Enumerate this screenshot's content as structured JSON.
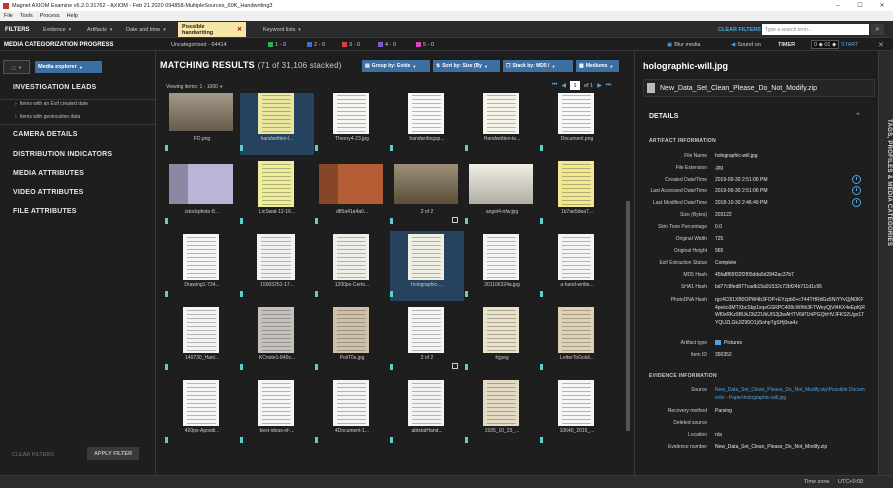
{
  "window": {
    "title": "Magnet AXIOM Examine v6.2.0.31762 - AXIOM - Feb 21 2020 094858-MultipleSources_60K_Handwriting3"
  },
  "menu": [
    "File",
    "Tools",
    "Process",
    "Help"
  ],
  "filter_bar": {
    "title": "FILTERS",
    "evidence": "Evidence",
    "artifacts": "Artifacts",
    "date_time": "Date and time",
    "active_filter": "Possible handwriting",
    "keyword": "Keyword lists",
    "clear": "CLEAR FILTERS",
    "search_placeholder": "Type a search term..."
  },
  "categorization": {
    "title": "MEDIA CATEGORIZATION PROGRESS",
    "uncategorized": "Uncategorized - 64414",
    "cats": [
      {
        "label": "1 - 0",
        "color": "#2eaf5a"
      },
      {
        "label": "2 - 0",
        "color": "#3b6fd4"
      },
      {
        "label": "3 - 0",
        "color": "#d44343"
      },
      {
        "label": "4 - 0",
        "color": "#7d5bc8"
      },
      {
        "label": "5 - 0",
        "color": "#d54ac2"
      }
    ],
    "blur": "Blur media",
    "sound": "Sound on",
    "timer": "TIMER",
    "timer_value": "0 ◆ 01 ◆",
    "start": "START"
  },
  "left_panel": {
    "explorer": "Media explorer",
    "investigation": "INVESTIGATION LEADS",
    "lead_items": [
      "Items with an Exif created date",
      "Items with geolocation data"
    ],
    "sections": [
      "CAMERA DETAILS",
      "DISTRIBUTION INDICATORS",
      "MEDIA ATTRIBUTES",
      "VIDEO ATTRIBUTES",
      "FILE ATTRIBUTES"
    ],
    "clear": "CLEAR FILTERS",
    "apply": "APPLY FILTER"
  },
  "results": {
    "title": "MATCHING RESULTS",
    "subtitle": "(71 of 31,106 stacked)",
    "group_by": "Group by: Evide",
    "sort_by": "Sort by: Size (By",
    "stack_by": "Stack by: MD5 /",
    "size": "Mediums",
    "viewing": "Viewing items: 1 - 1000",
    "page": "1",
    "page_of": "of 1",
    "items": [
      {
        "name": "FD.png",
        "tone": "#8a7a66",
        "kind": "photo",
        "tick": true,
        "stack": false
      },
      {
        "name": "handwritten-l...",
        "tone": "#ece7a0",
        "kind": "doc",
        "tick": true,
        "stack": false,
        "sel": true
      },
      {
        "name": "Theory4-23.jpg",
        "tone": "#f5f5f2",
        "kind": "doc",
        "tick": true,
        "stack": false
      },
      {
        "name": "handwritingsp...",
        "tone": "#f8f8f6",
        "kind": "doc",
        "tick": true,
        "stack": false
      },
      {
        "name": "Handwritten-le...",
        "tone": "#f5f3ea",
        "kind": "doc",
        "tick": true,
        "stack": false
      },
      {
        "name": "Document.png",
        "tone": "#f7f7f7",
        "kind": "doc",
        "tick": true,
        "stack": false
      },
      {
        "name": "istockphoto-8...",
        "tone": "#b9b5d8",
        "kind": "card",
        "tick": true,
        "stack": false
      },
      {
        "name": "LicSwat-12-16...",
        "tone": "#eeee99",
        "kind": "doc",
        "tick": true,
        "stack": false
      },
      {
        "name": "d85a41a4a0...",
        "tone": "#b55e36",
        "kind": "card",
        "tick": true,
        "stack": false
      },
      {
        "name": "2 of 2",
        "tone": "#7a6a4d",
        "kind": "photo",
        "tick": true,
        "stack": true
      },
      {
        "name": "angel4-nfw.jpg",
        "tone": "#ece8dc",
        "kind": "photo",
        "tick": true,
        "stack": false
      },
      {
        "name": "1b7ae5dea7...",
        "tone": "#f2e88e",
        "kind": "doc",
        "tick": true,
        "stack": false
      },
      {
        "name": "Drawing1-734...",
        "tone": "#f6f6f6",
        "kind": "doc",
        "tick": true,
        "stack": false
      },
      {
        "name": "15003251-17...",
        "tone": "#f1f1ef",
        "kind": "cert",
        "tick": true,
        "stack": false
      },
      {
        "name": "1200px-Certo...",
        "tone": "#efefe9",
        "kind": "doc",
        "tick": true,
        "stack": false
      },
      {
        "name": "holographic-...",
        "tone": "#efefe6",
        "kind": "doc",
        "tick": true,
        "stack": false,
        "sel": true
      },
      {
        "name": "201106324a.jpg",
        "tone": "#f4f4f4",
        "kind": "doc",
        "tick": true,
        "stack": false
      },
      {
        "name": "a-hand-writte...",
        "tone": "#f4f4f2",
        "kind": "doc",
        "tick": true,
        "stack": false
      },
      {
        "name": "140730_Hanl...",
        "tone": "#f3f3f3",
        "kind": "doc",
        "tick": true,
        "stack": false
      },
      {
        "name": "KCnote1-840x...",
        "tone": "#c6c2bb",
        "kind": "doc",
        "tick": true,
        "stack": false
      },
      {
        "name": "PoiiT0s.jpg",
        "tone": "#d0c0a8",
        "kind": "doc",
        "tick": true,
        "stack": false
      },
      {
        "name": "2 of 2",
        "tone": "#f4f4f4",
        "kind": "doc",
        "tick": true,
        "stack": true
      },
      {
        "name": "fcjpeg",
        "tone": "#e9e1c8",
        "kind": "doc",
        "tick": true,
        "stack": false
      },
      {
        "name": "LetterToGoldi...",
        "tone": "#dfd1b2",
        "kind": "doc",
        "tick": true,
        "stack": false
      },
      {
        "name": "420px-Apostil...",
        "tone": "#f6f6f6",
        "kind": "doc",
        "tick": true,
        "stack": false
      },
      {
        "name": "best-ideas-of-...",
        "tone": "#f5f5f5",
        "kind": "doc",
        "tick": true,
        "stack": false
      },
      {
        "name": "4Document-1...",
        "tone": "#f4f4f4",
        "kind": "doc",
        "tick": true,
        "stack": false
      },
      {
        "name": "abtstatHand...",
        "tone": "#f3f3f3",
        "kind": "doc",
        "tick": true,
        "stack": false
      },
      {
        "name": "1935_10_23_...",
        "tone": "#e5dac3",
        "kind": "doc",
        "tick": true,
        "stack": false
      },
      {
        "name": "10640_2015_...",
        "tone": "#f5f5f5",
        "kind": "doc",
        "tick": true,
        "stack": false
      }
    ]
  },
  "details": {
    "title": "holographic-will.jpg",
    "source_file": "New_Data_Set_Clean_Please_Do_Not_Modify.zip",
    "header": "DETAILS",
    "artifact_info": "ARTIFACT INFORMATION",
    "fields": [
      {
        "k": "File Name",
        "v": "holographic-will.jpg"
      },
      {
        "k": "File Extension",
        "v": ".jpg"
      },
      {
        "k": "Created Date/Time",
        "v": "2019-09-30 2:51:06 PM",
        "clock": true
      },
      {
        "k": "Last Accessed Date/Time",
        "v": "2019-09-30 2:51:06 PM",
        "clock": true
      },
      {
        "k": "Last Modified Date/Time",
        "v": "2018-10-30 2:46:49 PM",
        "clock": true
      },
      {
        "k": "Size (Bytes)",
        "v": "203122"
      },
      {
        "k": "Skin Tone Percentage",
        "v": "0.0"
      },
      {
        "k": "Original Width",
        "v": "725"
      },
      {
        "k": "Original Height",
        "v": "965"
      },
      {
        "k": "Exif Extraction Status",
        "v": "Complete"
      },
      {
        "k": "MD5 Hash",
        "v": "45fa8f65f32f2f05dda5d2842ac37b7"
      },
      {
        "k": "SHA1 Hash",
        "v": "bd77c8fed877cadb15a91532c72bf24b711d1c95"
      }
    ],
    "photodna_label": "PhotoDNA Hash",
    "photodna_value": "rgc4C0l1XB0OPW4b3FOP+EYzpb0+cT44THRdGs5NIYYvQjN0KF4peko3MTXbcSbp1xqeGSRPC408cWIhh3FTWeyQjVI4KX4eEpKjRWf0xRKz9BUkJ3tZZUbUIS3j3wAHTV6iP1hIPGQhHVJFKS2Ugo1TYQUZLGkJl295O1jiSohpTgSHj0sa4z",
    "artifact_type_label": "Artifact type",
    "artifact_type": "Pictures",
    "item_id_label": "Item ID",
    "item_id": "350352",
    "evidence_info": "EVIDENCE INFORMATION",
    "source_label": "Source",
    "source_value": "New_Data_Set_Clean_Please_Do_Not_Modify.zip\\Possible Documents - Paper\\holographic-will.jpg",
    "recovery_label": "Recovery method",
    "recovery_value": "Parsing",
    "deleted_label": "Deleted source",
    "deleted_value": "",
    "location_label": "Location",
    "location_value": "n/a",
    "evnum_label": "Evidence number",
    "evnum_value": "New_Data_Set_Clean_Please_Do_Not_Modify.zip"
  },
  "side_tab": "TAGS, PROFILES & MEDIA CATEGORIES",
  "status": {
    "tz_label": "Time zone",
    "tz": "UTC+0:00"
  }
}
